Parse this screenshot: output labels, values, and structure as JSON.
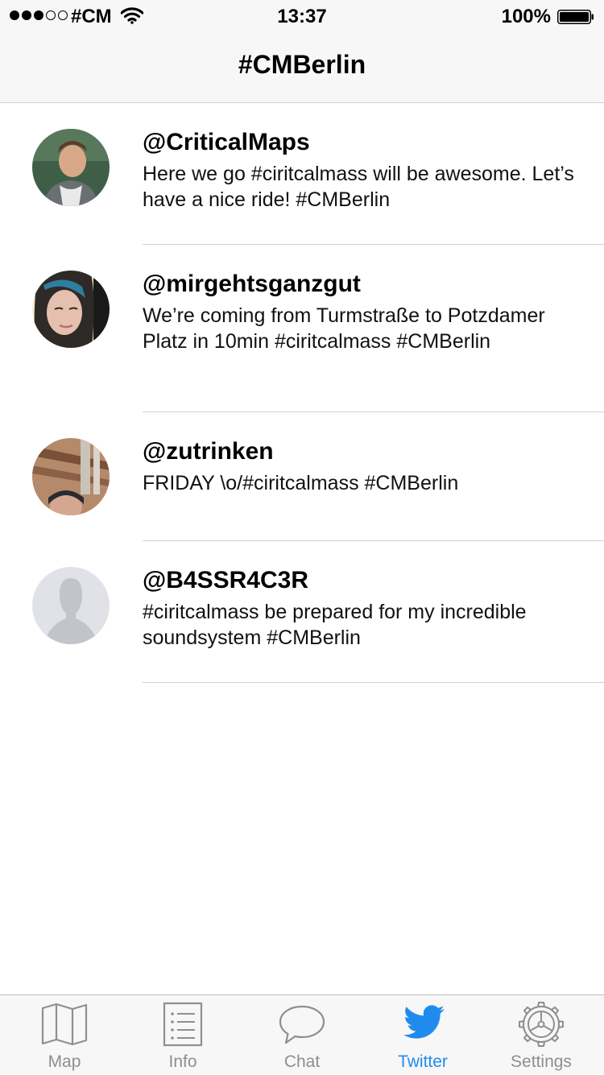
{
  "status_bar": {
    "carrier": "#CM",
    "time": "13:37",
    "battery": "100%"
  },
  "nav": {
    "title": "#CMBerlin"
  },
  "tweets": [
    {
      "handle": "@CriticalMaps",
      "text": "Here we go #ciritcalmass will be awesome. Let’s have a nice ride! #CMBerlin"
    },
    {
      "handle": "@mirgehtsganzgut",
      "text": "We’re coming from Turmstraße to Potzdamer Platz in 10min #ciritcalmass #CMBerlin"
    },
    {
      "handle": "@zutrinken",
      "text": "FRIDAY \\o/#ciritcalmass #CMBerlin"
    },
    {
      "handle": "@B4SSR4C3R",
      "text": "#ciritcalmass be prepared for my incredible soundsystem #CMBerlin"
    }
  ],
  "tabs": [
    {
      "label": "Map",
      "icon": "map-icon"
    },
    {
      "label": "Info",
      "icon": "list-icon"
    },
    {
      "label": "Chat",
      "icon": "chat-bubble-icon"
    },
    {
      "label": "Twitter",
      "icon": "twitter-bird-icon",
      "active": true
    },
    {
      "label": "Settings",
      "icon": "gear-icon"
    }
  ],
  "colors": {
    "accent": "#1f8ced",
    "inactive": "#8e8e93",
    "bar_background": "#f7f7f7"
  }
}
